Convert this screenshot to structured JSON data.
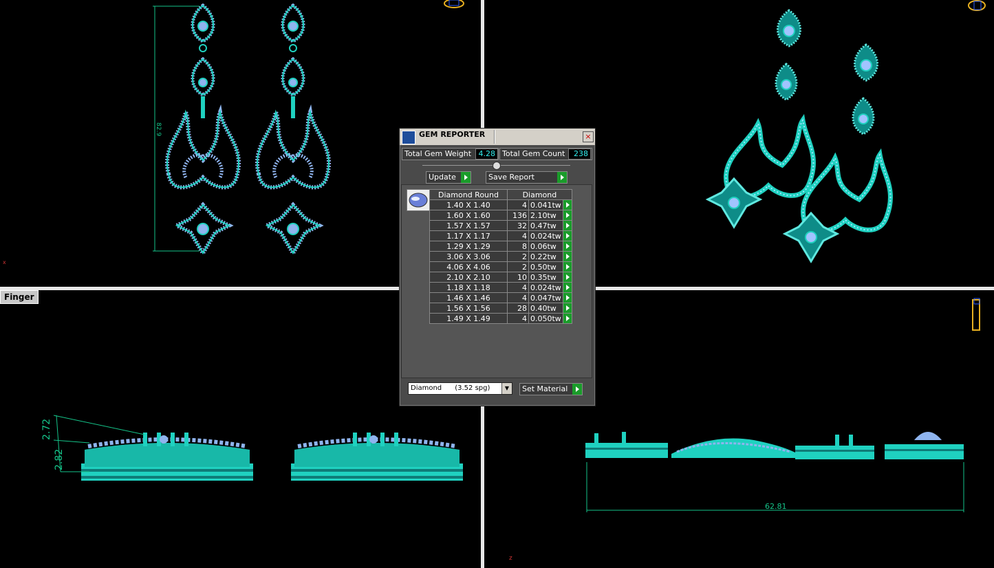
{
  "viewports": {
    "bottom_left_label": "Finger",
    "dimensions": {
      "tl_height": "82.9",
      "bl_top": "2.72",
      "bl_bottom": "2.82",
      "br_length": "62.81"
    },
    "axes": {
      "x": "x",
      "z": "z"
    }
  },
  "gem_reporter": {
    "title": "GEM REPORTER",
    "close": "×",
    "total_weight_label": "Total Gem Weight",
    "total_weight_value": "4.28",
    "total_count_label": "Total Gem Count",
    "total_count_value": "238",
    "update_label": "Update",
    "save_report_label": "Save Report",
    "table": {
      "headers": [
        "Diamond Round",
        "Diamond"
      ],
      "rows": [
        {
          "size": "1.40 X 1.40",
          "count": "4",
          "weight": "0.041tw"
        },
        {
          "size": "1.60 X 1.60",
          "count": "136",
          "weight": "2.10tw"
        },
        {
          "size": "1.57 X 1.57",
          "count": "32",
          "weight": "0.47tw"
        },
        {
          "size": "1.17 X 1.17",
          "count": "4",
          "weight": "0.024tw"
        },
        {
          "size": "1.29 X 1.29",
          "count": "8",
          "weight": "0.06tw"
        },
        {
          "size": "3.06 X 3.06",
          "count": "2",
          "weight": "0.22tw"
        },
        {
          "size": "4.06 X 4.06",
          "count": "2",
          "weight": "0.50tw"
        },
        {
          "size": "2.10 X 2.10",
          "count": "10",
          "weight": "0.35tw"
        },
        {
          "size": "1.18 X 1.18",
          "count": "4",
          "weight": "0.024tw"
        },
        {
          "size": "1.46 X 1.46",
          "count": "4",
          "weight": "0.047tw"
        },
        {
          "size": "1.56 X 1.56",
          "count": "28",
          "weight": "0.40tw"
        },
        {
          "size": "1.49 X 1.49",
          "count": "4",
          "weight": "0.050tw"
        }
      ]
    },
    "material_select": "Diamond      (3.52 spg)",
    "set_material_label": "Set Material"
  },
  "colors": {
    "metal": "#1fd1c0",
    "gem": "#8fb4ee",
    "dimension": "#15c58a",
    "panel": "#4a4a4a",
    "accent_green": "#1a9c2a"
  }
}
